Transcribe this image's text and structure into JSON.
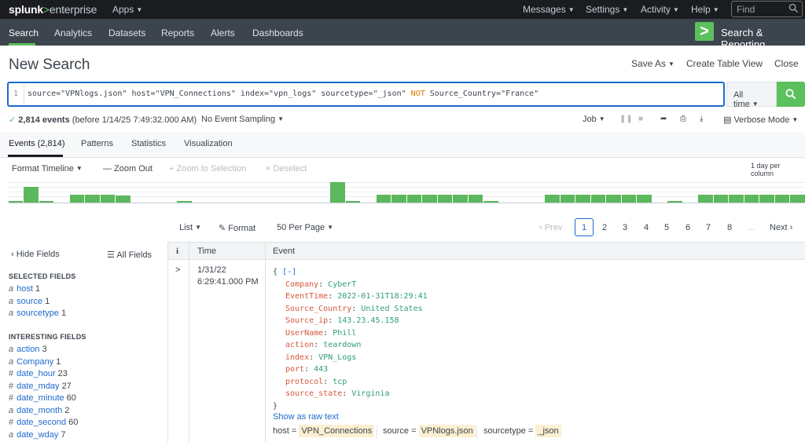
{
  "topbar": {
    "logo_main": "splunk",
    "logo_gt": ">",
    "logo_sub": "enterprise",
    "apps": "Apps",
    "messages": "Messages",
    "settings": "Settings",
    "activity": "Activity",
    "help": "Help",
    "find_placeholder": "Find"
  },
  "appbar": {
    "tabs": [
      "Search",
      "Analytics",
      "Datasets",
      "Reports",
      "Alerts",
      "Dashboards"
    ],
    "app_logo": ">",
    "app_name": "Search & Reporting"
  },
  "page": {
    "title": "New Search",
    "save_as": "Save As",
    "create_table_view": "Create Table View",
    "close": "Close"
  },
  "search": {
    "line_number": "1",
    "query_part1": "source=\"VPNlogs.json\" host=\"VPN_Connections\" index=\"vpn_logs\" sourcetype=\"_json\" ",
    "query_keyword": "NOT",
    "query_part2": " Source_Country=\"France\"",
    "time_range": "All time"
  },
  "status": {
    "event_count": "2,814 events",
    "before_text": "(before 1/14/25 7:49:32.000 AM)",
    "sampling": "No Event Sampling",
    "job": "Job",
    "mode": "Verbose Mode"
  },
  "results_tabs": [
    "Events (2,814)",
    "Patterns",
    "Statistics",
    "Visualization"
  ],
  "timeline": {
    "format_timeline": "Format Timeline",
    "zoom_out": "— Zoom Out",
    "zoom_to_selection": "+ Zoom to Selection",
    "deselect": "× Deselect",
    "scale_label": "1 day per column",
    "bar_levels": [
      0.05,
      0.62,
      0.05,
      0,
      0.32,
      0.32,
      0.32,
      0.27,
      0,
      0,
      0,
      0.05,
      0,
      0,
      0,
      0,
      0,
      0,
      0,
      0,
      0,
      0.82,
      0.05,
      0,
      0.32,
      0.32,
      0.32,
      0.32,
      0.32,
      0.32,
      0.32,
      0.05,
      0,
      0,
      0,
      0.32,
      0.32,
      0.32,
      0.32,
      0.32,
      0.32,
      0.32,
      0,
      0.05,
      0,
      0.32,
      0.32,
      0.32,
      0.32,
      0.32,
      0.32,
      0.32
    ]
  },
  "list_controls": {
    "list": "List",
    "format": "Format",
    "per_page": "50 Per Page",
    "prev": "‹ Prev",
    "pages": [
      "1",
      "2",
      "3",
      "4",
      "5",
      "6",
      "7",
      "8",
      "..."
    ],
    "next": "Next ›"
  },
  "sidebar": {
    "hide_fields": "‹ Hide Fields",
    "all_fields": "All Fields",
    "selected_header": "SELECTED FIELDS",
    "selected": [
      {
        "type": "a",
        "name": "host",
        "count": "1"
      },
      {
        "type": "a",
        "name": "source",
        "count": "1"
      },
      {
        "type": "a",
        "name": "sourcetype",
        "count": "1"
      }
    ],
    "interesting_header": "INTERESTING FIELDS",
    "interesting": [
      {
        "type": "a",
        "name": "action",
        "count": "3"
      },
      {
        "type": "a",
        "name": "Company",
        "count": "1"
      },
      {
        "type": "#",
        "name": "date_hour",
        "count": "23"
      },
      {
        "type": "#",
        "name": "date_mday",
        "count": "27"
      },
      {
        "type": "#",
        "name": "date_minute",
        "count": "60"
      },
      {
        "type": "a",
        "name": "date_month",
        "count": "2"
      },
      {
        "type": "#",
        "name": "date_second",
        "count": "60"
      },
      {
        "type": "a",
        "name": "date_wday",
        "count": "7"
      }
    ]
  },
  "table": {
    "col_info": "i",
    "col_time": "Time",
    "col_event": "Event"
  },
  "event": {
    "expander": ">",
    "date": "1/31/22",
    "time": "6:29:41.000 PM",
    "open_brace": "{",
    "collapse": "[-]",
    "close_brace": "}",
    "fields": [
      {
        "key": "Company",
        "value": "CyberT"
      },
      {
        "key": "EventTime",
        "value": "2022-01-31T18:29:41"
      },
      {
        "key": "Source_Country",
        "value": "United States"
      },
      {
        "key": "Source_ip",
        "value": "143.23.45.158"
      },
      {
        "key": "UserName",
        "value": "Phill"
      },
      {
        "key": "action",
        "value": "teardown"
      },
      {
        "key": "index",
        "value": "VPN_Logs"
      },
      {
        "key": "port",
        "value": "443"
      },
      {
        "key": "protocol",
        "value": "tcp"
      },
      {
        "key": "source_state",
        "value": "Virginia"
      }
    ],
    "show_raw": "Show as raw text",
    "meta": [
      {
        "label": "host =",
        "value": "VPN_Connections"
      },
      {
        "label": "source =",
        "value": "VPNlogs.json"
      },
      {
        "label": "sourcetype =",
        "value": "_json"
      }
    ]
  }
}
